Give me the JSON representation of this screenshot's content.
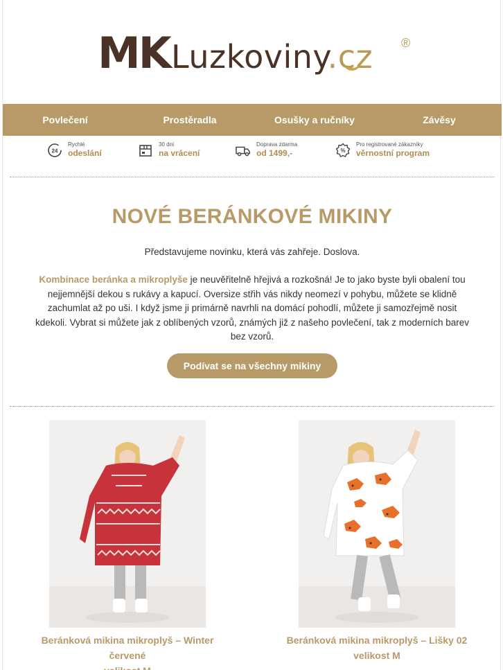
{
  "logo": {
    "mk": "MK",
    "brand": "Luzkoviny",
    "tld": ".cz",
    "reg": "®"
  },
  "nav": {
    "items": [
      "Povlečení",
      "Prostěradla",
      "Osušky a ručníky",
      "Závěsy"
    ]
  },
  "benefits": [
    {
      "icon": "24h-icon",
      "small": "Rychlé",
      "big": "odeslání"
    },
    {
      "icon": "box-icon",
      "small": "30 dní",
      "big": "na vrácení"
    },
    {
      "icon": "truck-icon",
      "small": "Doprava zdarma",
      "big": "od 1499,-"
    },
    {
      "icon": "loyalty-icon",
      "small": "Pro registrované zákazníky",
      "big": "věrnostní program"
    }
  ],
  "hero": {
    "title": "NOVÉ BERÁNKOVÉ MIKINY",
    "intro": "Představujeme novinku, která vás zahřeje. Doslova.",
    "highlight": "Kombinace beránka a mikroplyše",
    "body": " je neuvěřitelně hřejivá a rozkošná! Je to jako byste byli obalení tou nejjemnější dekou s rukávy a kapucí. Oversize střih vás nikdy neomezí v pohybu, můžete se klidně zachumlat až po uši. I když jsme ji primárně navrhli na domácí pohodlí, můžete ji samozřejmě nosit kdekoli. Vybrat si můžete jak z oblíbených vzorů, známých již z našeho povlečení, tak z moderních barev bez vzorů.",
    "cta": "Podívat se na všechny mikiny"
  },
  "products": [
    {
      "name_line1": "Beránková mikina mikroplyš – Winter červené",
      "name_line2": "velikost M",
      "color": "#c8323b"
    },
    {
      "name_line1": "Beránková mikina mikroplyš – Lišky 02",
      "name_line2": "velikost M",
      "color": "#e8702a"
    }
  ]
}
